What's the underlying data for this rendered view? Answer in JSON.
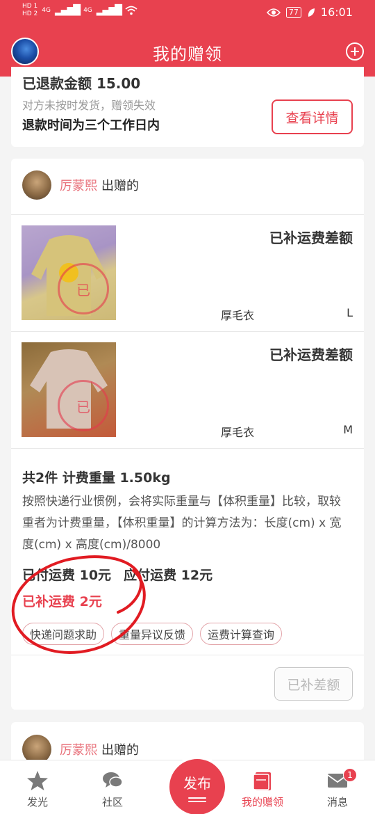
{
  "status_bar": {
    "sim1": "HD 1",
    "sim2": "HD 2",
    "network1": "4G",
    "network2": "4G",
    "battery": "77",
    "time": "16:01"
  },
  "header": {
    "title": "我的赠领"
  },
  "refund_card": {
    "amount": "已退款金额 15.00",
    "reason": "对方未按时发货，赠领失效",
    "time_note": "退款时间为三个工作日内",
    "detail_button": "查看详情"
  },
  "gift_card": {
    "giver_name": "厉蒙熙",
    "giver_suffix": "出赠的",
    "items": [
      {
        "status": "已补运费差额",
        "name": "厚毛衣",
        "size": "L",
        "stamp_text": "已"
      },
      {
        "status": "已补运费差额",
        "name": "厚毛衣",
        "size": "M",
        "stamp_text": "已"
      }
    ],
    "summary_title": "共2件 计费重量 1.50kg",
    "summary_desc": "按照快递行业惯例，会将实际重量与【体积重量】比较，取较重者为计费重量，【体积重量】的计算方法为：长度(cm) x 宽度(cm) x 高度(cm)/8000",
    "paid_fee": "已付运费 10元",
    "due_fee": "应付运费 12元",
    "extra_paid": "已补运费 2元",
    "tags": [
      "快递问题求助",
      "重量异议反馈",
      "运费计算查询"
    ],
    "action_button": "已补差额"
  },
  "next_card": {
    "giver_name": "厉蒙熙",
    "giver_suffix": "出赠的"
  },
  "tabbar": {
    "tabs": [
      {
        "label": "发光",
        "icon": "star-icon"
      },
      {
        "label": "社区",
        "icon": "chat-bubbles-icon"
      },
      {
        "label": "发布",
        "icon": "publish-icon"
      },
      {
        "label": "我的赠领",
        "icon": "gift-box-icon"
      },
      {
        "label": "消息",
        "icon": "mail-icon"
      }
    ],
    "message_badge": "1"
  },
  "colors": {
    "brand": "#e8414f",
    "giver_name": "#e8707a",
    "muted": "#999999"
  }
}
